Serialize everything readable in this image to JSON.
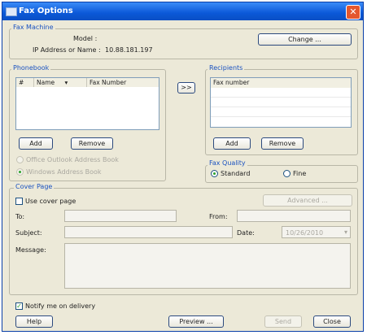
{
  "window": {
    "title": "Fax Options",
    "close_glyph": "✕"
  },
  "fax_machine": {
    "group_label": "Fax Machine",
    "model_label": "Model :",
    "model_value": "",
    "ip_label": "IP Address or Name :",
    "ip_value": "10.88.181.197",
    "change_button": "Change ..."
  },
  "phonebook": {
    "group_label": "Phonebook",
    "columns": [
      "#",
      "Name",
      "Fax Number"
    ],
    "sort_glyph": "▾",
    "add_button": "Add",
    "remove_button": "Remove",
    "option_outlook": "Office Outlook Address Book",
    "option_windows": "Windows Address Book"
  },
  "move_button": ">>",
  "recipients": {
    "group_label": "Recipients",
    "columns": [
      "Fax number"
    ],
    "add_button": "Add",
    "remove_button": "Remove"
  },
  "fax_quality": {
    "group_label": "Fax Quality",
    "standard": "Standard",
    "fine": "Fine",
    "selected": "Standard"
  },
  "cover_page": {
    "group_label": "Cover Page",
    "use_cover_label": "Use cover page",
    "advanced_button": "Advanced ...",
    "to_label": "To:",
    "from_label": "From:",
    "subject_label": "Subject:",
    "date_label": "Date:",
    "date_value": "10/26/2010",
    "message_label": "Message:"
  },
  "notify": {
    "label": "Notify me on delivery",
    "checked": true,
    "check_glyph": "✓"
  },
  "footer": {
    "help": "Help",
    "preview": "Preview ...",
    "send": "Send",
    "close": "Close"
  },
  "colors": {
    "title_bar": "#0b58d8",
    "group_label": "#1a52c0",
    "dialog_bg": "#ece9d8"
  }
}
